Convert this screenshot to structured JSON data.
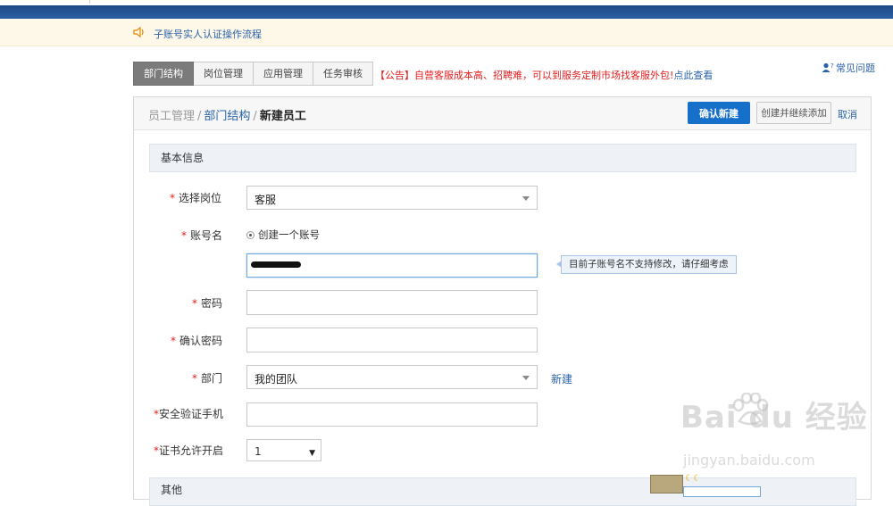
{
  "notice": {
    "text": "子账号实人认证操作流程"
  },
  "tabs": [
    {
      "label": "部门结构",
      "active": true
    },
    {
      "label": "岗位管理",
      "active": false
    },
    {
      "label": "应用管理",
      "active": false
    },
    {
      "label": "任务审核",
      "active": false
    }
  ],
  "announcement": {
    "text": "【公告】自营客服成本高、招聘难，可以到服务定制市场找客服外包!",
    "link": "点此查看"
  },
  "faq": {
    "label": "常见问题"
  },
  "breadcrumb": {
    "root": "员工管理",
    "sep": "/",
    "parent": "部门结构",
    "current": "新建员工"
  },
  "actions": {
    "confirm": "确认新建",
    "create_continue": "创建并继续添加",
    "cancel": "取消"
  },
  "section_basic": "基本信息",
  "form": {
    "req_mark": "*",
    "position": {
      "label": "选择岗位",
      "value": "客服"
    },
    "account": {
      "label": "账号名",
      "radio": "创建一个账号",
      "tooltip": "目前子账号名不支持修改，请仔细考虑"
    },
    "password": {
      "label": "密码"
    },
    "confirm_password": {
      "label": "确认密码"
    },
    "department": {
      "label": "部门",
      "value": "我的团队",
      "new_link": "新建"
    },
    "security_phone": {
      "label": "安全验证手机"
    },
    "cert": {
      "label": "证书允许开启",
      "value": "1"
    }
  },
  "section_other": "其他",
  "watermark": {
    "main": "Bai du 经验",
    "sub": "jingyan.baidu.com"
  },
  "colors": {
    "primary": "#1670c9",
    "link": "#2a62a8",
    "required": "#e02020",
    "header_bar": "#2b5ea3"
  }
}
